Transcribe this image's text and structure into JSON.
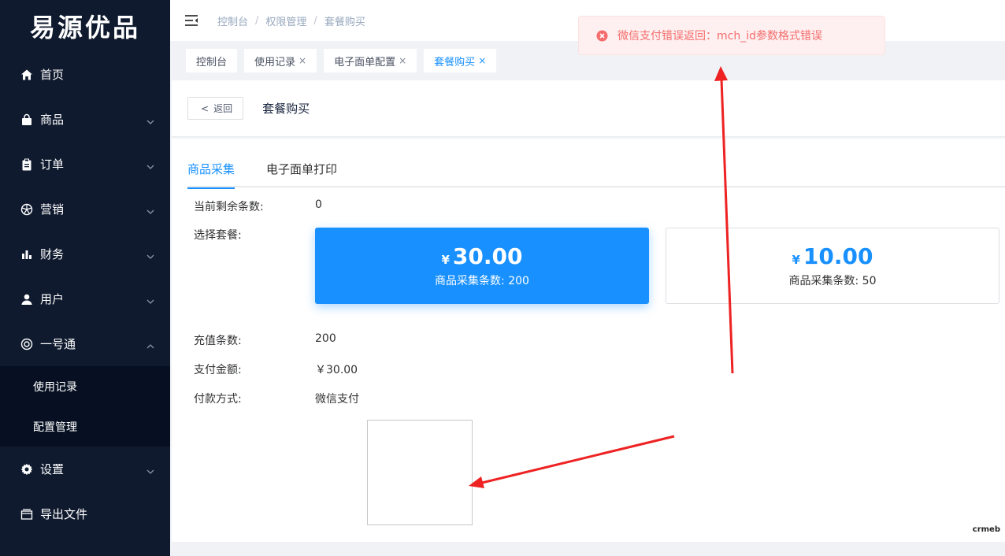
{
  "sidebar": {
    "logo": "易源优品",
    "items": [
      {
        "label": "首页",
        "icon": "home-icon",
        "expandable": false
      },
      {
        "label": "商品",
        "icon": "shopping-bag-icon",
        "expandable": true
      },
      {
        "label": "订单",
        "icon": "clipboard-icon",
        "expandable": true
      },
      {
        "label": "营销",
        "icon": "aperture-icon",
        "expandable": true
      },
      {
        "label": "财务",
        "icon": "bar-chart-icon",
        "expandable": true
      },
      {
        "label": "用户",
        "icon": "user-icon",
        "expandable": true
      },
      {
        "label": "一号通",
        "icon": "lifebuoy-icon",
        "expandable": true,
        "expanded": true
      },
      {
        "label": "设置",
        "icon": "gear-icon",
        "expandable": true
      },
      {
        "label": "导出文件",
        "icon": "folder-icon",
        "expandable": false
      }
    ],
    "submenu": [
      "使用记录",
      "配置管理"
    ]
  },
  "header": {
    "breadcrumb": [
      "控制台",
      "权限管理",
      "套餐购买"
    ],
    "separator": "/"
  },
  "tags": [
    {
      "label": "控制台",
      "closable": false,
      "active": false
    },
    {
      "label": "使用记录",
      "closable": true,
      "active": false
    },
    {
      "label": "电子面单配置",
      "closable": true,
      "active": false
    },
    {
      "label": "套餐购买",
      "closable": true,
      "active": true
    }
  ],
  "tag_close": "×",
  "page_head": {
    "back_arrow": "<",
    "back_label": "返回",
    "title": "套餐购买"
  },
  "tabs": [
    {
      "label": "商品采集",
      "active": true
    },
    {
      "label": "电子面单打印",
      "active": false
    }
  ],
  "form": {
    "remaining_label": "当前剩余条数:",
    "remaining_value": "0",
    "package_label": "选择套餐:",
    "packages": [
      {
        "currency": "¥",
        "price": "30.00",
        "desc": "商品采集条数: 200",
        "selected": true
      },
      {
        "currency": "¥",
        "price": "10.00",
        "desc": "商品采集条数: 50",
        "selected": false
      }
    ],
    "recharge_label": "充值条数:",
    "recharge_value": "200",
    "amount_label": "支付金额:",
    "amount_value": "￥30.00",
    "method_label": "付款方式:",
    "method_value": "微信支付"
  },
  "watermark": "crmeb",
  "toast": {
    "message": "微信支付错误返回：mch_id参数格式错误",
    "type": "error"
  },
  "colors": {
    "sidebar_bg": "#0f1a2e",
    "primary": "#1890ff",
    "price_red": "#f5222d",
    "pay_green": "#19be6b",
    "error_text": "#f56c6c",
    "annotation_arrow": "#ee2222"
  }
}
